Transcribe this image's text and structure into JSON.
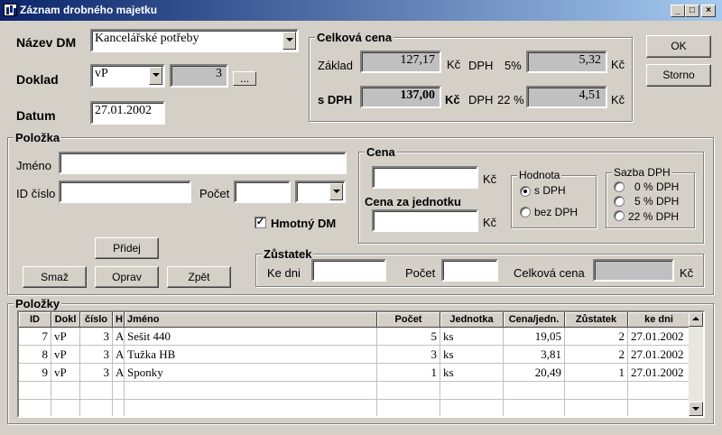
{
  "window": {
    "title": "Záznam drobného majetku",
    "caption_buttons": [
      "_",
      "□",
      "×"
    ]
  },
  "header": {
    "nazev_label": "Název DM",
    "nazev_value": "Kancelářské potřeby",
    "doklad_label": "Doklad",
    "doklad_value": "vP",
    "doklad_number": "3",
    "doklad_browse": "...",
    "datum_label": "Datum",
    "datum_value": "27.01.2002"
  },
  "total": {
    "group_label": "Celková cena",
    "zaklad_label": "Základ",
    "zaklad_value": "127,17",
    "sdph_label": "s DPH",
    "sdph_value": "137,00",
    "currency": "Kč",
    "dph_label": "DPH",
    "dph5_rate": "5%",
    "dph5_value": "5,32",
    "dph22_rate": "22 %",
    "dph22_value": "4,51"
  },
  "actions": {
    "ok": "OK",
    "storno": "Storno"
  },
  "item": {
    "group_label": "Položka",
    "jmeno_label": "Jméno",
    "jmeno_value": "",
    "id_label": "ID číslo",
    "id_value": "",
    "pocet_label": "Počet",
    "pocet_value": "",
    "unit_value": "",
    "hmotny_label": "Hmotný DM",
    "hmotny_checked": true,
    "pridej": "Přidej",
    "smaz": "Smaž",
    "oprav": "Oprav",
    "zpet": "Zpět"
  },
  "price": {
    "group_label": "Cena",
    "cena_value": "",
    "cena_unit_label": "Cena za jednotku",
    "cena_unit_value": "",
    "currency": "Kč",
    "hodnota_label": "Hodnota",
    "hodnota_options": [
      "s DPH",
      "bez DPH"
    ],
    "hodnota_selected": 0,
    "sazba_label": "Sazba DPH",
    "sazba_options": [
      "0 % DPH",
      "5 % DPH",
      "22 % DPH"
    ]
  },
  "zustatek": {
    "group_label": "Zůstatek",
    "ke_dni_label": "Ke dni",
    "ke_dni_value": "",
    "pocet_label": "Počet",
    "pocet_value": "",
    "celkova_label": "Celková cena",
    "celkova_value": "",
    "currency": "Kč"
  },
  "items_table": {
    "group_label": "Položky",
    "columns": [
      "ID",
      "Dokl",
      "číslo",
      "H",
      "Jméno",
      "Počet",
      "Jednotka",
      "Cena/jedn.",
      "Zůstatek",
      "ke dni"
    ],
    "rows": [
      [
        "7",
        "vP",
        "3",
        "A",
        "Sešit 440",
        "5",
        "ks",
        "19,05",
        "2",
        "27.01.2002"
      ],
      [
        "8",
        "vP",
        "3",
        "A",
        "Tužka HB",
        "3",
        "ks",
        "3,81",
        "2",
        "27.01.2002"
      ],
      [
        "9",
        "vP",
        "3",
        "A",
        "Sponky",
        "1",
        "ks",
        "20,49",
        "1",
        "27.01.2002"
      ]
    ]
  }
}
